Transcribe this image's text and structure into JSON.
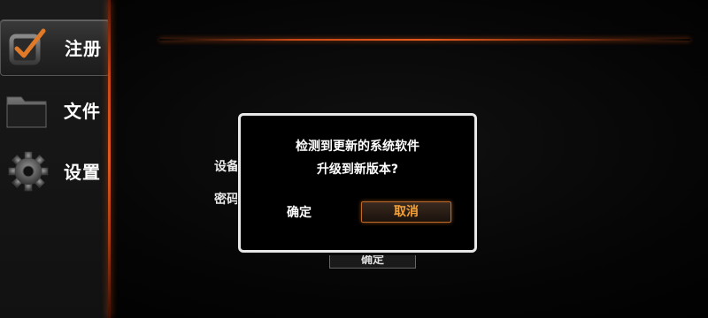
{
  "sidebar": {
    "items": [
      {
        "label": "注册",
        "icon": "checkbox-edit-icon",
        "active": true
      },
      {
        "label": "文件",
        "icon": "folder-icon",
        "active": false
      },
      {
        "label": "设置",
        "icon": "gear-icon",
        "active": false
      }
    ]
  },
  "background_form": {
    "device_label": "设备",
    "password_label": "密码",
    "confirm_button": "确定"
  },
  "dialog": {
    "line1": "检测到更新的系统软件",
    "line2": "升级到新版本?",
    "ok_label": "确定",
    "cancel_label": "取消"
  },
  "colors": {
    "accent": "#e05a20",
    "cancel_text": "#f3a23a",
    "dialog_border": "#e8e8e8"
  }
}
